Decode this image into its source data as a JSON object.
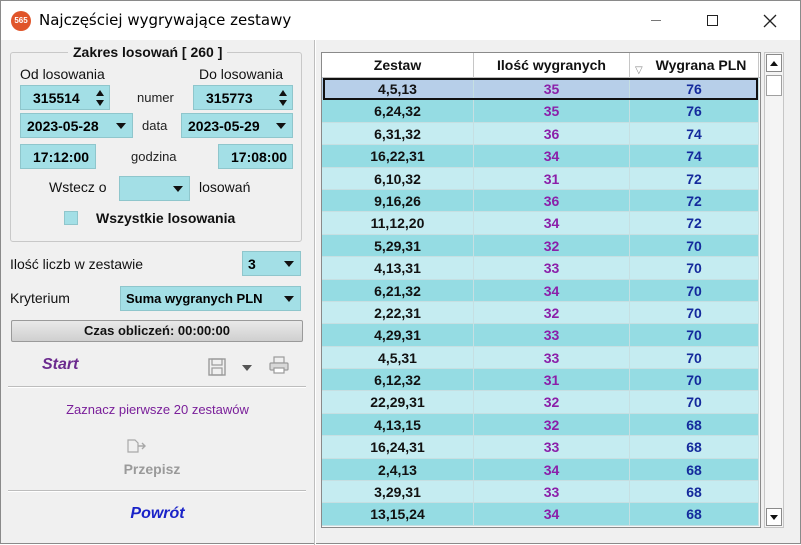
{
  "window": {
    "title": "Najczęściej wygrywające zestawy",
    "app_icon_text": "565",
    "controls": [
      "minimize-icon",
      "maximize-icon",
      "close-icon"
    ]
  },
  "range": {
    "legend": "Zakres losowań  [ 260 ]",
    "from_label": "Od losowania",
    "to_label": "Do losowania",
    "number_label": "numer",
    "from_number": "315514",
    "to_number": "315773",
    "date_label": "data",
    "from_date": "2023-05-28",
    "to_date": "2023-05-29",
    "time_label": "godzina",
    "from_time": "17:12:00",
    "to_time": "17:08:00",
    "back_label": "Wstecz o",
    "back_value": "",
    "back_unit": "losowań",
    "all_label": "Wszystkie losowania",
    "all_checked": false
  },
  "options": {
    "count_label": "Ilość liczb w zestawie",
    "count_value": "3",
    "criterion_label": "Kryterium",
    "criterion_value": "Suma wygranych PLN"
  },
  "progress_text": "Czas obliczeń: 00:00:00",
  "actions": {
    "start": "Start",
    "mark_first": "Zaznacz pierwsze 20 zestawów",
    "copy": "Przepisz",
    "back": "Powrót",
    "icons": [
      "save-icon",
      "dropdown-caret-icon",
      "print-icon",
      "copy-icon"
    ]
  },
  "table": {
    "columns": [
      "Zestaw",
      "Ilość wygranych",
      "Wygrana PLN"
    ],
    "sort_column": "Wygrana PLN",
    "selected_row": 0,
    "rows": [
      [
        "4,5,13",
        "35",
        "76"
      ],
      [
        "6,24,32",
        "35",
        "76"
      ],
      [
        "6,31,32",
        "36",
        "74"
      ],
      [
        "16,22,31",
        "34",
        "74"
      ],
      [
        "6,10,32",
        "31",
        "72"
      ],
      [
        "9,16,26",
        "36",
        "72"
      ],
      [
        "11,12,20",
        "34",
        "72"
      ],
      [
        "5,29,31",
        "32",
        "70"
      ],
      [
        "4,13,31",
        "33",
        "70"
      ],
      [
        "6,21,32",
        "34",
        "70"
      ],
      [
        "2,22,31",
        "32",
        "70"
      ],
      [
        "4,29,31",
        "33",
        "70"
      ],
      [
        "4,5,31",
        "33",
        "70"
      ],
      [
        "6,12,32",
        "31",
        "70"
      ],
      [
        "22,29,31",
        "32",
        "70"
      ],
      [
        "4,13,15",
        "32",
        "68"
      ],
      [
        "16,24,31",
        "33",
        "68"
      ],
      [
        "2,4,13",
        "34",
        "68"
      ],
      [
        "3,29,31",
        "33",
        "68"
      ],
      [
        "13,15,24",
        "34",
        "68"
      ]
    ]
  },
  "colors": {
    "field_bg": "#a3dfe6",
    "row_light": "#c5ecf1",
    "row_dark": "#95dce3",
    "count_text": "#8b1fa9",
    "win_text": "#142a9c",
    "start_text": "#6b2a8e",
    "back_text": "#1a23c8"
  }
}
